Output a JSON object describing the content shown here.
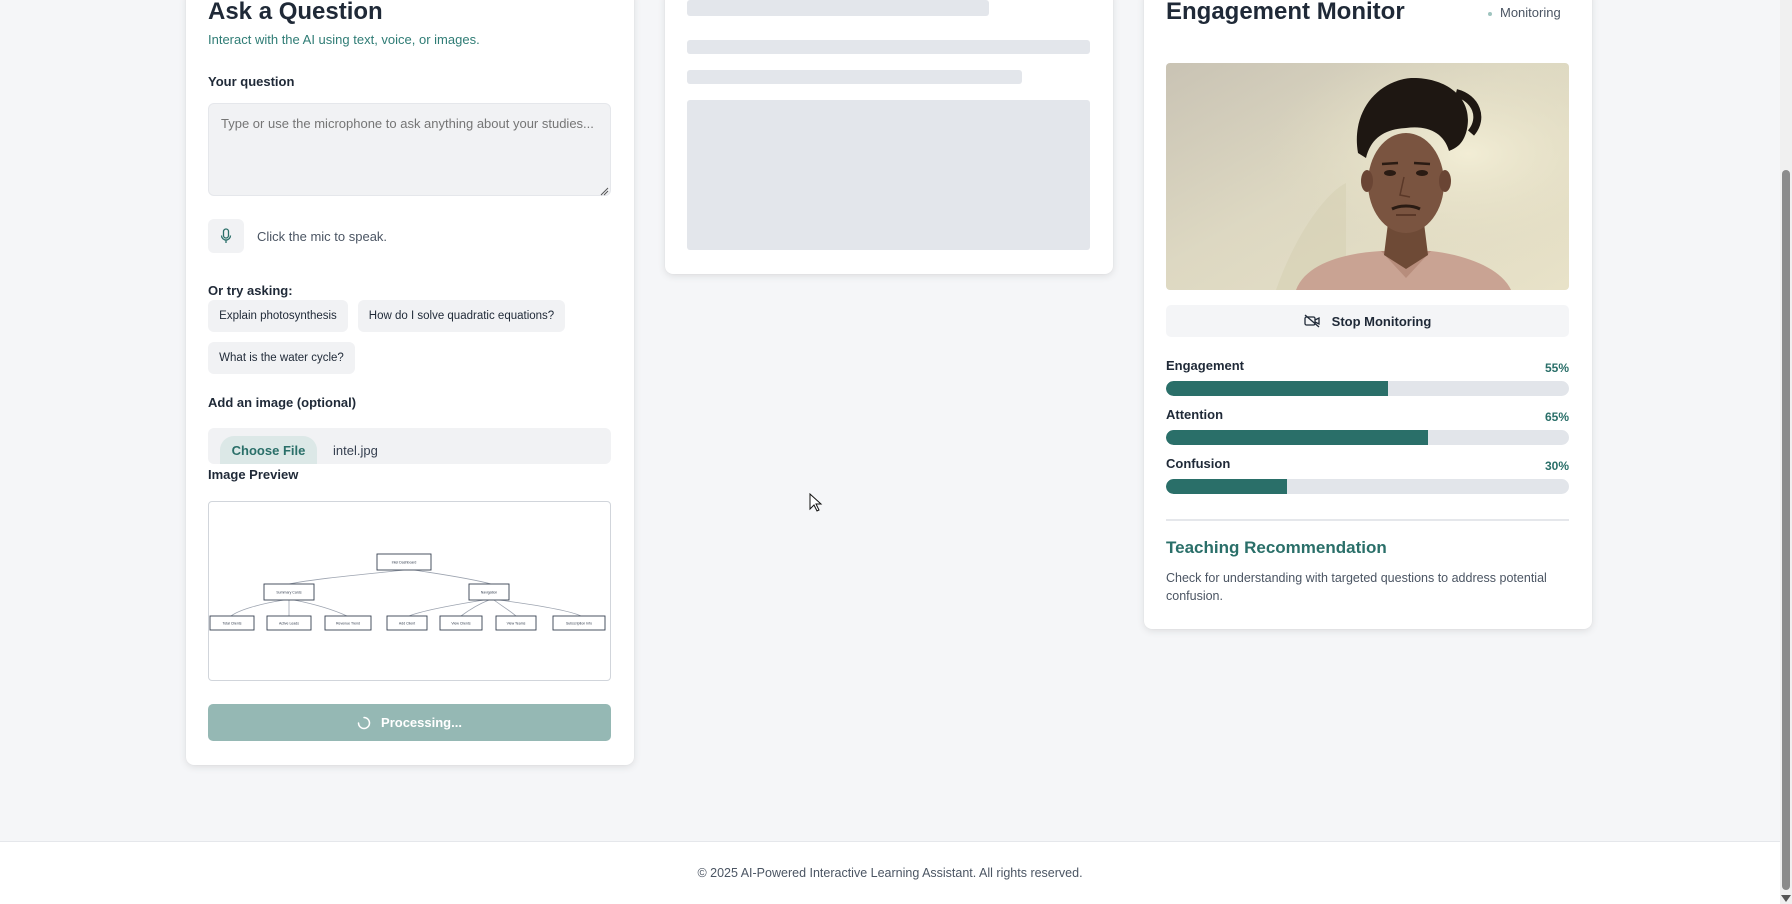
{
  "left": {
    "title": "Ask a Question",
    "subtitle": "Interact with the AI using text, voice, or images.",
    "question_label": "Your question",
    "question_placeholder": "Type or use the microphone to ask anything about your studies...",
    "question_value": "",
    "mic_hint": "Click the mic to speak.",
    "suggestions_label": "Or try asking:",
    "suggestions": [
      "Explain photosynthesis",
      "How do I solve quadratic equations?",
      "What is the water cycle?"
    ],
    "image_label": "Add an image (optional)",
    "choose_file_label": "Choose File",
    "file_name": "intel.jpg",
    "preview_label": "Image Preview",
    "preview_nodes": [
      "Intel Dashboard",
      "Summary Cards",
      "Navigation",
      "Total Clients",
      "Active Leads",
      "Revenue Trend",
      "Add Client",
      "View Clients",
      "View Teams",
      "Subscription Info"
    ],
    "processing_label": "Processing..."
  },
  "right": {
    "title": "Engagement Monitor",
    "status": "Monitoring",
    "stop_label": "Stop Monitoring",
    "metrics": [
      {
        "label": "Engagement",
        "value": "55%",
        "fraction": 0.55
      },
      {
        "label": "Attention",
        "value": "65%",
        "fraction": 0.65
      },
      {
        "label": "Confusion",
        "value": "30%",
        "fraction": 0.3
      }
    ],
    "recommendation_title": "Teaching Recommendation",
    "recommendation_text": "Check for understanding with targeted questions to address potential confusion."
  },
  "footer": {
    "text": "© 2025 AI-Powered Interactive Learning Assistant. All rights reserved."
  },
  "colors": {
    "accent": "#2a6f69",
    "accent_muted": "#95b8b4",
    "background": "#f5f6f8"
  }
}
